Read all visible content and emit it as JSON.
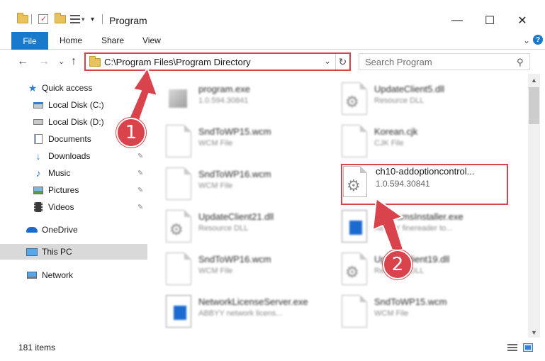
{
  "window": {
    "title": "Program",
    "minimize": "—",
    "maximize": "☐",
    "close": "✕"
  },
  "ribbon": {
    "tabs": [
      "File",
      "Home",
      "Share",
      "View"
    ],
    "expand": "⌄",
    "help": "?"
  },
  "nav": {
    "back": "←",
    "forward": "→",
    "recent": "⌄",
    "up": "↑",
    "address": "C:\\Program Files\\Program Directory",
    "dropdown": "⌄",
    "refresh": "↻",
    "search_placeholder": "Search Program",
    "search_icon": "⚲"
  },
  "sidebar": {
    "items": [
      {
        "label": "Quick access",
        "icon": "star-icon"
      },
      {
        "label": "Local Disk (C:)",
        "icon": "drive-icon"
      },
      {
        "label": "Local Disk (D:)",
        "icon": "drive-icon"
      },
      {
        "label": "Documents",
        "icon": "documents-icon"
      },
      {
        "label": "Downloads",
        "icon": "download-icon"
      },
      {
        "label": "Music",
        "icon": "music-icon"
      },
      {
        "label": "Pictures",
        "icon": "pictures-icon"
      },
      {
        "label": "Videos",
        "icon": "videos-icon"
      },
      {
        "label": "OneDrive",
        "icon": "cloud-icon"
      },
      {
        "label": "This PC",
        "icon": "computer-icon"
      },
      {
        "label": "Network",
        "icon": "network-icon"
      }
    ],
    "pin": "✎"
  },
  "files": [
    {
      "name": "program.exe",
      "sub": "1.0.594.30841",
      "kind": "exe"
    },
    {
      "name": "UpdateClient5.dll",
      "sub": "Resource DLL",
      "kind": "dll"
    },
    {
      "name": "SndToWP15.wcm",
      "sub": "WCM File",
      "kind": "blank"
    },
    {
      "name": "Korean.cjk",
      "sub": "CJK File",
      "kind": "blank"
    },
    {
      "name": "SndToWP16.wcm",
      "sub": "WCM File",
      "kind": "blank"
    },
    {
      "name": "ch10-addoptioncontrol...",
      "sub": "1.0.594.30841",
      "kind": "dll"
    },
    {
      "name": "UpdateClient21.dll",
      "sub": "Resource DLL",
      "kind": "dll"
    },
    {
      "name": "ProgramsInstaller.exe",
      "sub": "ABBYY finereader to...",
      "kind": "app"
    },
    {
      "name": "SndToWP16.wcm",
      "sub": "WCM File",
      "kind": "blank"
    },
    {
      "name": "UpdateClient19.dll",
      "sub": "Resource DLL",
      "kind": "dll"
    },
    {
      "name": "NetworkLicenseServer.exe",
      "sub": "ABBYY network licens...",
      "kind": "app"
    },
    {
      "name": "SndToWP15.wcm",
      "sub": "WCM File",
      "kind": "blank"
    }
  ],
  "status": {
    "count": "181 items"
  },
  "callouts": {
    "one": "1",
    "two": "2",
    "color": "#d9434b"
  }
}
